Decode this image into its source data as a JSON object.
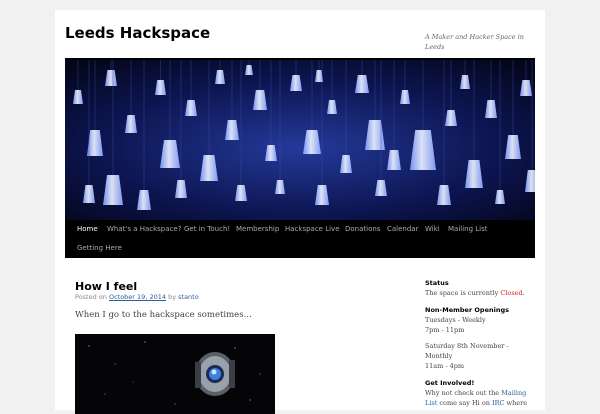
{
  "site": {
    "title": "Leeds Hackspace",
    "tagline": "A Maker and Hacker Space in Leeds"
  },
  "nav": {
    "items": [
      {
        "label": "Home"
      },
      {
        "label": "What's a Hackspace?"
      },
      {
        "label": "Get in Touch!"
      },
      {
        "label": "Membership"
      },
      {
        "label": "Hackspace Live"
      },
      {
        "label": "Donations"
      },
      {
        "label": "Calendar"
      },
      {
        "label": "Wiki"
      },
      {
        "label": "Mailing List"
      },
      {
        "label": "Getting Here"
      }
    ]
  },
  "post": {
    "title": "How I feel",
    "meta_prefix": "Posted on",
    "date": "October 19, 2014",
    "meta_by": "by",
    "author": "stanto",
    "excerpt": "When I go to the hackspace sometimes..."
  },
  "sidebar": {
    "status_title": "Status",
    "status_text": "The space is currently",
    "status_value": "Closed",
    "status_period": ".",
    "openings_title": "Non-Member Openings",
    "openings_line1": "Tuesdays - Weekly",
    "openings_line2": "7pm - 11pm",
    "openings_line3": "Saturday 8th November -",
    "openings_line4": "Monthly",
    "openings_line5": "11am - 4pm",
    "involved_title": "Get Involved!",
    "involved_text": "Why not check out the",
    "involved_link": "Mailing",
    "involved_text2": "List",
    "involved_text3": "come say Hi on",
    "involved_link2": "IRC",
    "involved_text4": "where"
  },
  "colors": {
    "accent_link": "#2b5e96",
    "status_closed": "#d41c1c",
    "nav_bg": "#000000"
  }
}
